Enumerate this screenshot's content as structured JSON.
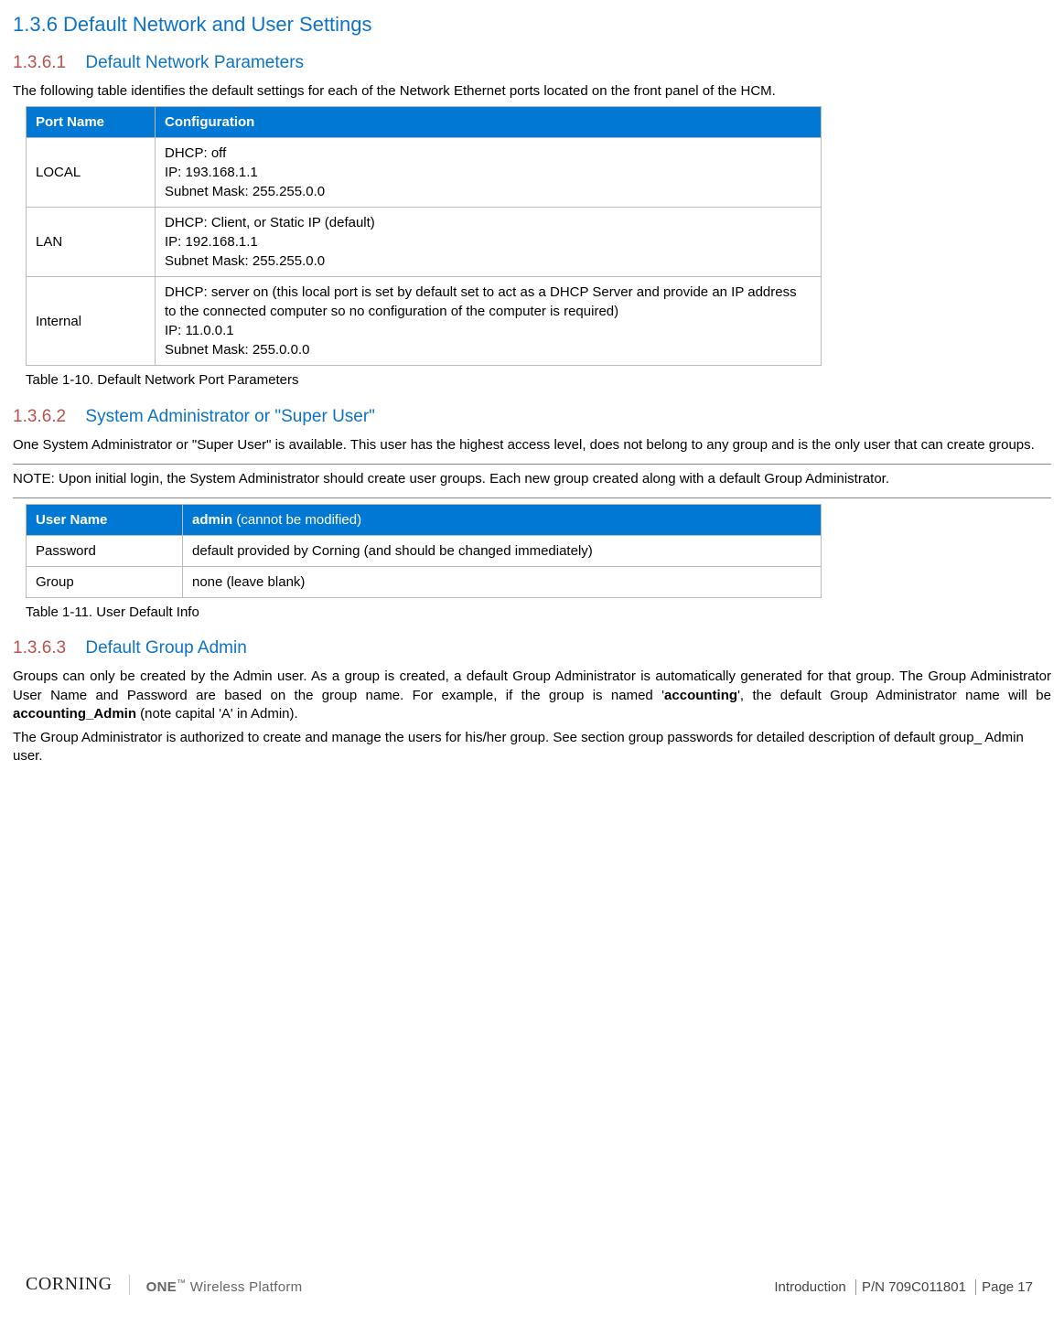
{
  "section": {
    "num_title": "1.3.6 Default Network and User Settings"
  },
  "sub1": {
    "num": "1.3.6.1",
    "title": "Default Network Parameters",
    "intro": "The following table identifies the default settings for each of the Network Ethernet ports located on the front panel of the HCM.",
    "table": {
      "hdr_port": "Port Name",
      "hdr_conf": "Configuration",
      "rows": [
        {
          "port": "LOCAL",
          "conf": "DHCP: off\nIP: 193.168.1.1\nSubnet Mask: 255.255.0.0"
        },
        {
          "port": "LAN",
          "conf": "DHCP: Client, or Static IP (default)\nIP: 192.168.1.1\nSubnet Mask: 255.255.0.0"
        },
        {
          "port": "Internal",
          "conf": "DHCP: server on (this local port is set by default set to act as a DHCP Server and provide an IP address to the connected computer so no configuration of the computer is required)\nIP: 11.0.0.1\nSubnet Mask: 255.0.0.0\n "
        }
      ]
    },
    "caption": "Table 1-10. Default Network Port Parameters"
  },
  "sub2": {
    "num": "1.3.6.2",
    "title": "System Administrator or \"Super User\"",
    "p1": "One System Administrator or \"Super User\" is available. This user has the highest access level, does not belong to any group and is the only user that can create groups.",
    "note": "NOTE: Upon initial login, the System Administrator should create user groups. Each new group created along with a default Group Administrator.",
    "table": {
      "hdr_user": "User Name",
      "hdr_admin_bold": "admin",
      "hdr_admin_rest": " (cannot be modified)",
      "rows": [
        {
          "k": "Password",
          "v": "default provided by Corning (and should be changed immediately)"
        },
        {
          "k": "Group",
          "v": "none (leave blank)\n "
        }
      ]
    },
    "caption": "Table 1-11. User Default Info"
  },
  "sub3": {
    "num": "1.3.6.3",
    "title": "Default Group Admin",
    "p1_pre": "Groups can only be created by the Admin user. As a group is created, a default Group Administrator is automatically generated for that group. The Group Administrator User Name and Password are based on the group name. For example, if the group is named '",
    "p1_b1": "accounting",
    "p1_mid": "', the default Group Administrator name will be ",
    "p1_b2": "accounting_Admin",
    "p1_post": " (note capital 'A' in Admin).",
    "p2": "The Group Administrator is authorized to create and manage the users for his/her group. See section group passwords for detailed description of default group_ Admin user."
  },
  "footer": {
    "brand": "CORNING",
    "platform_one": "ONE",
    "platform_rest": " Wireless Platform",
    "section": "Introduction",
    "pn": "P/N 709C011801",
    "page": "Page 17"
  }
}
